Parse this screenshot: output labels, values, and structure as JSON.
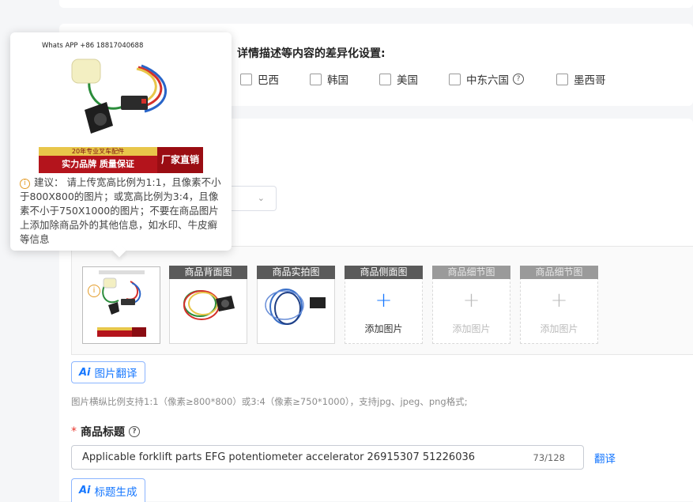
{
  "differentiation": {
    "title": "详情描述等内容的差异化设置:",
    "countries": [
      {
        "label": "巴西",
        "checked": false
      },
      {
        "label": "韩国",
        "checked": false
      },
      {
        "label": "美国",
        "checked": false
      },
      {
        "label": "中东六国",
        "checked": false,
        "help": "?"
      },
      {
        "label": "墨西哥",
        "checked": false
      }
    ]
  },
  "popup": {
    "phone": "Whats APP +86 18817040688",
    "banner_small": "20年专业叉车配件",
    "banner_main": "实力品牌   质量保证",
    "banner_right": "厂家直销",
    "advice": "建议：  请上传宽高比例为1:1，且像素不小于800X800的图片；或宽高比例为3:4，且像素不小于750X1000的图片；不要在商品图片上添加除商品外的其他信息，如水印、牛皮癣等信息"
  },
  "image_slots": [
    {
      "caption": "",
      "state": "filled",
      "warning": "i"
    },
    {
      "caption": "商品背面图",
      "state": "filled"
    },
    {
      "caption": "商品实拍图",
      "state": "filled"
    },
    {
      "caption": "商品侧面图",
      "state": "empty",
      "add_label": "添加图片",
      "plus": "+"
    },
    {
      "caption": "商品细节图",
      "state": "disabled",
      "add_label": "添加图片",
      "plus": "+"
    },
    {
      "caption": "商品细节图",
      "state": "disabled",
      "add_label": "添加图片",
      "plus": "+"
    }
  ],
  "image_translate_button": {
    "icon": "Ai",
    "label": "图片翻译"
  },
  "image_hint": "图片横纵比例支持1:1（像素≥800*800）或3:4（像素≥750*1000），支持jpg、jpeg、png格式;",
  "title_field": {
    "required_mark": "*",
    "label": "商品标题",
    "help": "?",
    "value": "Applicable forklift parts EFG potentiometer accelerator 26915307 51226036",
    "count": "73/128",
    "translate": "翻译"
  },
  "title_gen_button": {
    "icon": "Ai",
    "label": "标题生成"
  },
  "colors": {
    "accent": "#1677ff",
    "required": "#e8362d",
    "warning": "#e39b27"
  }
}
